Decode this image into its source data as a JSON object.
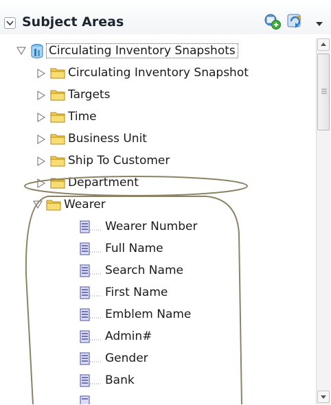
{
  "header": {
    "title": "Subject Areas",
    "icons": [
      "collapse-icon",
      "create-analysis-icon",
      "refresh-icon",
      "chevron-down-icon"
    ]
  },
  "tree": {
    "root": {
      "label": "Circulating Inventory Snapshots",
      "icon": "subject-area-icon",
      "expanded": true
    },
    "folders": [
      {
        "label": "Circulating Inventory Snapshot",
        "expanded": false
      },
      {
        "label": "Targets",
        "expanded": false
      },
      {
        "label": "Time",
        "expanded": false
      },
      {
        "label": "Business Unit",
        "expanded": false
      },
      {
        "label": "Ship To Customer",
        "expanded": false
      },
      {
        "label": "Department",
        "expanded": false,
        "highlighted": true
      },
      {
        "label": "Wearer",
        "expanded": true,
        "highlighted": true
      }
    ],
    "wearer_columns": [
      {
        "label": "Wearer Number"
      },
      {
        "label": "Full Name"
      },
      {
        "label": "Search Name"
      },
      {
        "label": "First Name"
      },
      {
        "label": "Emblem Name"
      },
      {
        "label": "Admin#"
      },
      {
        "label": "Gender"
      },
      {
        "label": "Bank"
      }
    ]
  },
  "colors": {
    "annotation": "#8b8264",
    "folder": "#f2cf4f",
    "column_icon": "#6e72c4",
    "root_icon": "#3a8fd6"
  }
}
